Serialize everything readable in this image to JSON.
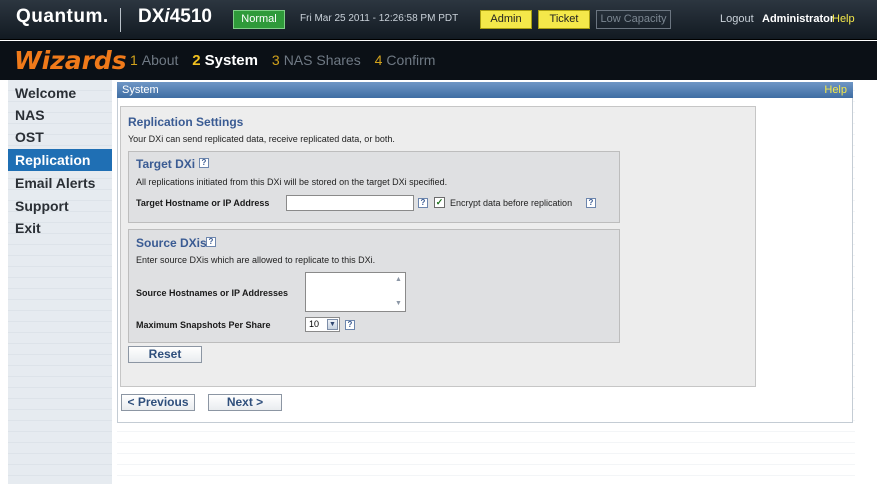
{
  "header": {
    "brand": "Quantum",
    "model_prefix": "DX",
    "model_italic": "i",
    "model_number": "4510",
    "status_badge": "Normal",
    "datetime": "Fri Mar 25 2011 - 12:26:58 PM PDT",
    "admin_badge": "Admin",
    "ticket_badge": "Ticket",
    "capacity_badge": "Low Capacity",
    "logout": "Logout",
    "user": "Administrator",
    "help": "Help"
  },
  "wizard": {
    "title": "Wizards",
    "steps": [
      {
        "num": "1",
        "label": "About",
        "active": false
      },
      {
        "num": "2",
        "label": "System",
        "active": true
      },
      {
        "num": "3",
        "label": "NAS Shares",
        "active": false
      },
      {
        "num": "4",
        "label": "Confirm",
        "active": false
      }
    ]
  },
  "sidebar": {
    "items": [
      {
        "label": "Welcome",
        "active": false
      },
      {
        "label": "NAS",
        "active": false
      },
      {
        "label": "OST",
        "active": false
      },
      {
        "label": "Replication",
        "active": true
      },
      {
        "label": "Email Alerts",
        "active": false
      },
      {
        "label": "Support",
        "active": false
      },
      {
        "label": "Exit",
        "active": false
      }
    ]
  },
  "panel": {
    "title": "System",
    "help": "Help"
  },
  "replication": {
    "heading": "Replication Settings",
    "description": "Your DXi can send replicated data, receive replicated data, or both."
  },
  "target": {
    "heading": "Target DXi",
    "description": "All replications initiated from this DXi will be stored on the target DXi specified.",
    "hostname_label": "Target Hostname or IP Address",
    "hostname_value": "",
    "encrypt_label": "Encrypt data before replication",
    "encrypt_checked": true
  },
  "source": {
    "heading": "Source DXis",
    "description": "Enter source DXis which are allowed to replicate to this DXi.",
    "hostnames_label": "Source Hostnames or IP Addresses",
    "snapshots_label": "Maximum Snapshots Per Share",
    "snapshots_value": "10"
  },
  "buttons": {
    "reset": "Reset",
    "previous": "< Previous",
    "next": "Next >"
  },
  "icons": {
    "help": "?",
    "check": "✓",
    "arrow_up": "▲",
    "arrow_down": "▼"
  },
  "colors": {
    "accent_blue": "#1f6fb4",
    "wizard_orange": "#f07a1a",
    "status_green": "#2f9a3a",
    "badge_yellow": "#f4e84a",
    "heading_blue": "#3a5b93"
  }
}
